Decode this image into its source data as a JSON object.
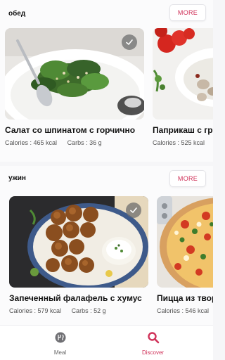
{
  "sections": [
    {
      "title": "обед",
      "more_label": "MORE",
      "cards": [
        {
          "title": "Салат со шпинатом с горчично",
          "calories": "Calories : 465 kcal",
          "carbs": "Carbs : 36 g",
          "checked": true
        },
        {
          "title": "Паприкаш с гр",
          "calories": "Calories : 525 kcal",
          "carbs": "",
          "checked": false
        }
      ]
    },
    {
      "title": "ужин",
      "more_label": "MORE",
      "cards": [
        {
          "title": "Запеченный фалафель с хумус",
          "calories": "Calories : 579 kcal",
          "carbs": "Carbs : 52 g",
          "checked": true
        },
        {
          "title": "Пицца из твор",
          "calories": "Calories : 546 kcal",
          "carbs": "",
          "checked": false
        }
      ]
    }
  ],
  "tabbar": {
    "meal_label": "Meal",
    "discover_label": "Discover",
    "active": "discover"
  },
  "colors": {
    "accent": "#d0335a",
    "inactive": "#777777",
    "background": "#f6f6f8"
  }
}
